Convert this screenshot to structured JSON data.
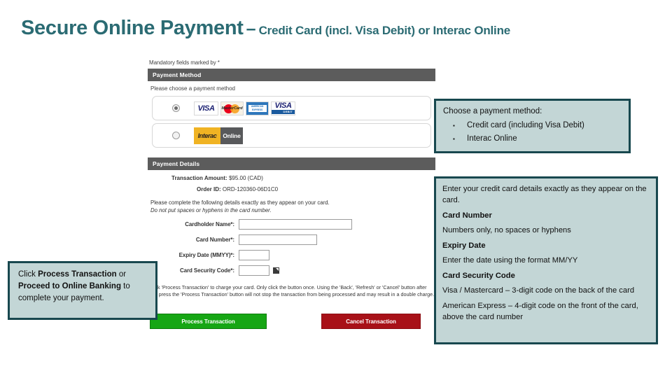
{
  "title": {
    "main": "Secure Online Payment",
    "dash": "–",
    "sub": "Credit Card (incl. Visa Debit) or Interac Online",
    "color": "#2b6b73"
  },
  "form": {
    "mandatory_note": "Mandatory fields marked by *",
    "payment_method": {
      "section_title": "Payment Method",
      "intro": "Please choose a payment method",
      "options": [
        {
          "id": "credit-card",
          "selected": true,
          "logos": [
            "VISA",
            "MasterCard",
            "American Express",
            "VISA Debit"
          ]
        },
        {
          "id": "interac-online",
          "selected": false,
          "logos": [
            "Interac Online"
          ]
        }
      ],
      "logo_text": {
        "visa": "VISA",
        "mastercard": "MasterCard",
        "amex_line1": "AMERICAN",
        "amex_line2": "EXPRESS",
        "visa_debit_top": "VISA",
        "visa_debit_bottom": "DEBIT",
        "interac": "Interac",
        "online": "Online"
      }
    },
    "payment_details": {
      "section_title": "Payment Details",
      "transaction_amount_label": "Transaction Amount:",
      "transaction_amount_value": "$95.00 (CAD)",
      "order_id_label": "Order ID:",
      "order_id_value": "ORD-120360-06D1C0",
      "note_line1": "Please complete the following details exactly as they appear on your card.",
      "note_line2": "Do not put spaces or hyphens in the card number.",
      "fields": [
        {
          "label": "Cardholder Name*:",
          "value": "",
          "size": "name"
        },
        {
          "label": "Card Number*:",
          "value": "",
          "size": "num"
        },
        {
          "label": "Expiry Date (MMYY)*:",
          "value": "",
          "size": "exp"
        },
        {
          "label": "Card Security Code*:",
          "value": "",
          "size": "csc"
        }
      ],
      "disclaimer": "Click 'Process Transaction' to charge your card. Only click the button once. Using the 'Back', 'Refresh' or 'Cancel' button after you press the 'Process Transaction' button will not stop the transaction from being processed and may result in a double charge.",
      "buttons": {
        "process": "Process Transaction",
        "cancel": "Cancel Transaction"
      }
    }
  },
  "callouts": {
    "methods": {
      "heading": "Choose a payment method:",
      "items": [
        "Credit card (including Visa Debit)",
        "Interac Online"
      ]
    },
    "details": {
      "intro": "Enter your credit card details exactly as they appear on the card.",
      "blocks": [
        {
          "label": "Card Number",
          "text": "Numbers only, no spaces or hyphens"
        },
        {
          "label": "Expiry Date",
          "text": "Enter the date using the format MM/YY"
        },
        {
          "label": "Card Security Code",
          "text": "Visa / Mastercard – 3-digit code on the back of the card"
        },
        {
          "label": "",
          "text": "American Express – 4-digit code on the front of the card, above the card number"
        }
      ]
    },
    "left": {
      "text_part1": "Click ",
      "bold1": "Process Transaction",
      "text_part2": " or ",
      "bold2": "Proceed to Online Banking",
      "text_part3": " to complete your payment."
    }
  },
  "colors": {
    "accent_teal": "#2b6b73",
    "callout_bg": "#c3d6d6",
    "callout_border": "#18484f",
    "section_bar": "#5c5c5c",
    "process_green": "#16a614",
    "cancel_red": "#a81118"
  }
}
